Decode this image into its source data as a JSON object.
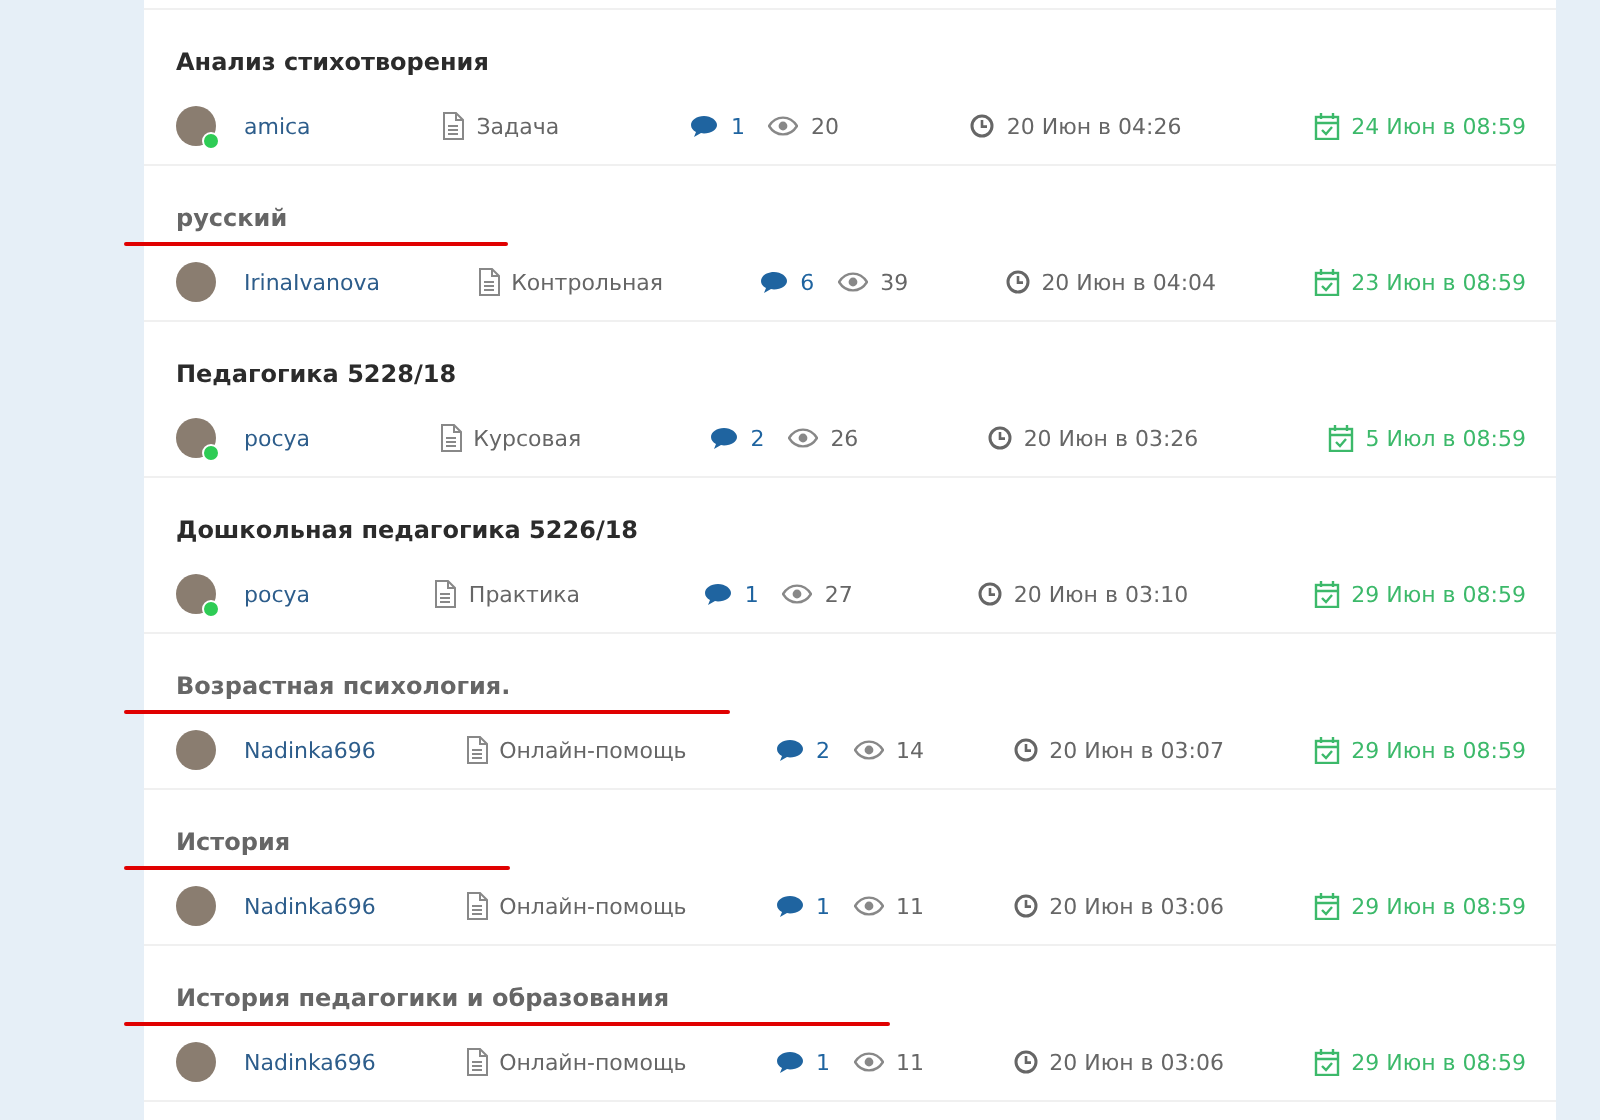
{
  "tasks": [
    {
      "title": "Анализ стихотворения",
      "visited": false,
      "underlined": false,
      "author": "amica",
      "online": true,
      "type": "Задача",
      "comments": "1",
      "views": "20",
      "created": "20 Июн в 04:26",
      "deadline": "24 Июн в 08:59"
    },
    {
      "title": "русский",
      "visited": true,
      "underlined": true,
      "author": "IrinaIvanova",
      "online": false,
      "type": "Контрольная",
      "comments": "6",
      "views": "39",
      "created": "20 Июн в 04:04",
      "deadline": "23 Июн в 08:59"
    },
    {
      "title": "Педагогика 5228/18",
      "visited": false,
      "underlined": false,
      "author": "pocya",
      "online": true,
      "type": "Курсовая",
      "comments": "2",
      "views": "26",
      "created": "20 Июн в 03:26",
      "deadline": "5 Июл в 08:59"
    },
    {
      "title": "Дошкольная педагогика 5226/18",
      "visited": false,
      "underlined": false,
      "author": "pocya",
      "online": true,
      "type": "Практика",
      "comments": "1",
      "views": "27",
      "created": "20 Июн в 03:10",
      "deadline": "29 Июн в 08:59"
    },
    {
      "title": "Возрастная психология.",
      "visited": true,
      "underlined": true,
      "author": "Nadinka696",
      "online": false,
      "type": "Онлайн-помощь",
      "comments": "2",
      "views": "14",
      "created": "20 Июн в 03:07",
      "deadline": "29 Июн в 08:59"
    },
    {
      "title": "История",
      "visited": true,
      "underlined": true,
      "author": "Nadinka696",
      "online": false,
      "type": "Онлайн-помощь",
      "comments": "1",
      "views": "11",
      "created": "20 Июн в 03:06",
      "deadline": "29 Июн в 08:59"
    },
    {
      "title": "История педагогики и образования",
      "visited": true,
      "underlined": true,
      "author": "Nadinka696",
      "online": false,
      "type": "Онлайн-помощь",
      "comments": "1",
      "views": "11",
      "created": "20 Июн в 03:06",
      "deadline": "29 Июн в 08:59"
    }
  ]
}
